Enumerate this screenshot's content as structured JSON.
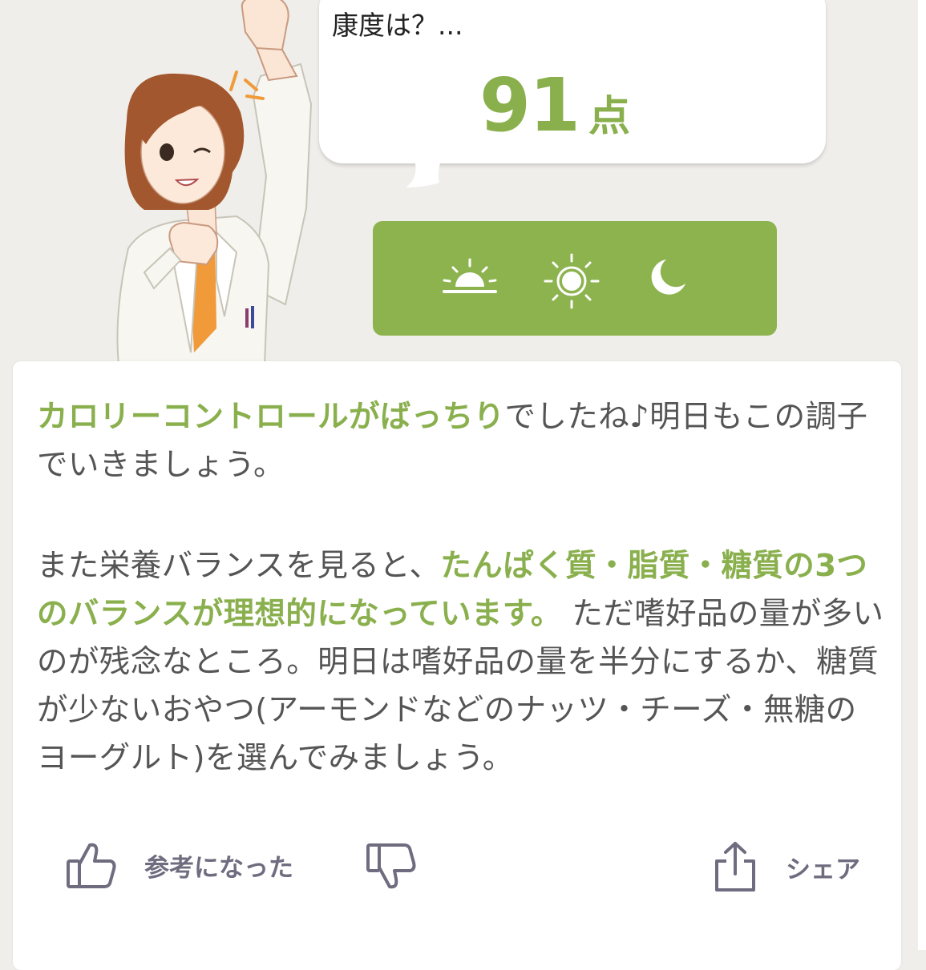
{
  "bubble": {
    "question": "康度は？...",
    "score": "91",
    "unit": "点"
  },
  "time_bar": {
    "color": "#8db34f",
    "icons": [
      "sunrise-icon",
      "sun-icon",
      "moon-icon"
    ]
  },
  "message": {
    "p1_highlight": "カロリーコントロールがばっちり",
    "p1_rest": "でしたね♪明日もこの調子でいきましょう。",
    "p2_start": "また栄養バランスを見ると、",
    "p2_highlight": "たんぱく質・脂質・糖質の3つのバランスが理想的になっています。",
    "p2_rest": " ただ嗜好品の量が多いのが残念なところ。明日は嗜好品の量を半分にするか、糖質が少ないおやつ(アーモンドなどのナッツ・チーズ・無糖のヨーグルト)を選んでみましょう。"
  },
  "actions": {
    "helpful_label": "参考になった",
    "share_label": "シェア"
  },
  "colors": {
    "accent": "#8ab04e",
    "text": "#555555",
    "background": "#efeeea",
    "action": "#6f6c7f"
  }
}
